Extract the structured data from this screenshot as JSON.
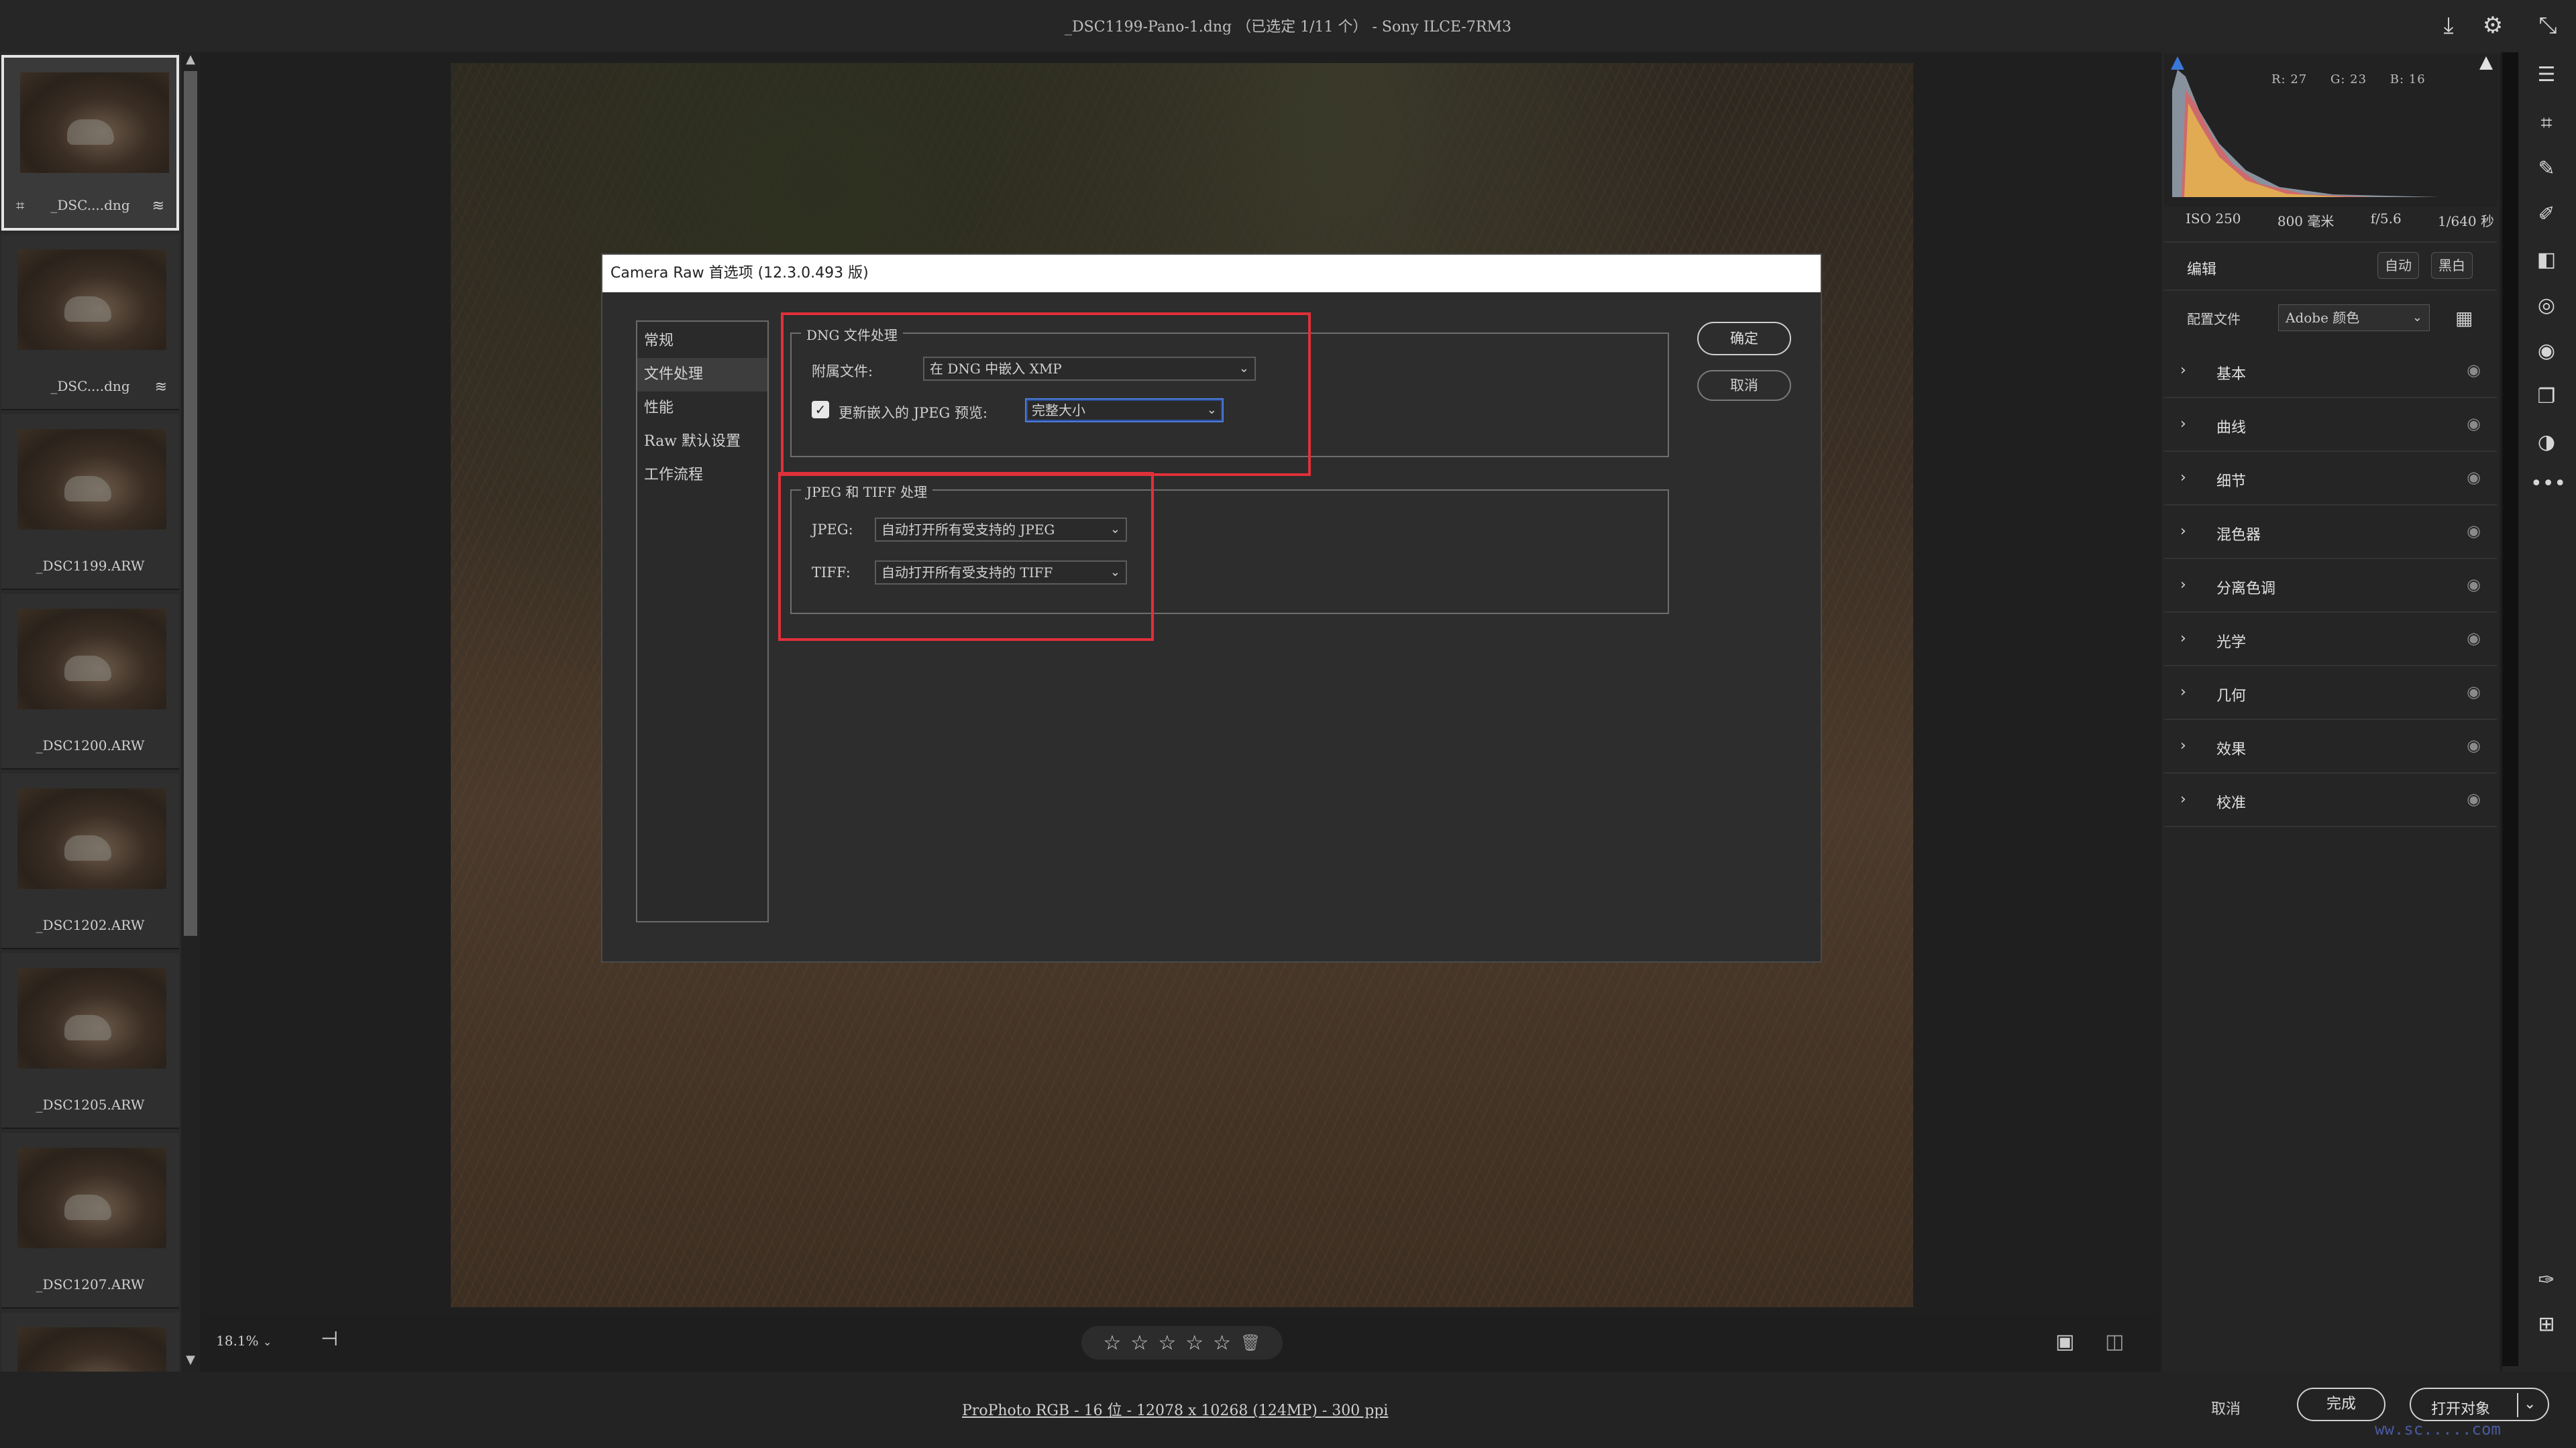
{
  "window": {
    "title": "_DSC1199-Pano-1.dng （已选定 1/11 个） - Sony ILCE-7RM3",
    "save_icon": "save-icon",
    "settings_icon": "gear-icon",
    "fullscreen_icon": "fullscreen-icon"
  },
  "filmstrip": {
    "items": [
      {
        "name": "_DSC....dng",
        "selected": true,
        "left_icon": "crop-icon",
        "right_icon": "adjust-icon"
      },
      {
        "name": "_DSC....dng",
        "selected": false,
        "left_icon": "",
        "right_icon": "adjust-icon"
      },
      {
        "name": "_DSC1199.ARW",
        "selected": false
      },
      {
        "name": "_DSC1200.ARW",
        "selected": false
      },
      {
        "name": "_DSC1202.ARW",
        "selected": false
      },
      {
        "name": "_DSC1205.ARW",
        "selected": false
      },
      {
        "name": "_DSC1207.ARW",
        "selected": false
      }
    ]
  },
  "canvas": {
    "zoom": "18.1%"
  },
  "rating": {
    "stars": 0,
    "max": 5
  },
  "histogram": {
    "r": "R: 27",
    "g": "G: 23",
    "b": "B: 16"
  },
  "exif": {
    "iso": "ISO 250",
    "focal": "800 毫米",
    "aperture": "f/5.6",
    "shutter": "1/640 秒"
  },
  "edit": {
    "title": "编辑",
    "auto": "自动",
    "bw": "黑白",
    "profile_label": "配置文件",
    "profile_value": "Adobe 颜色",
    "sections": [
      "基本",
      "曲线",
      "细节",
      "混色器",
      "分离色调",
      "光学",
      "几何",
      "效果",
      "校准"
    ]
  },
  "dialog": {
    "title": "Camera Raw 首选项 (12.3.0.493 版)",
    "nav": [
      "常规",
      "文件处理",
      "性能",
      "Raw 默认设置",
      "工作流程"
    ],
    "active_nav": 1,
    "dng_group": {
      "title": "DNG 文件处理",
      "sidecar_label": "附属文件:",
      "sidecar_value": "在 DNG 中嵌入 XMP",
      "update_preview_label": "更新嵌入的 JPEG 预览:",
      "update_preview_checked": true,
      "preview_size_value": "完整大小"
    },
    "jpeg_group": {
      "title": "JPEG 和 TIFF 处理",
      "jpeg_label": "JPEG:",
      "jpeg_value": "自动打开所有受支持的 JPEG",
      "tiff_label": "TIFF:",
      "tiff_value": "自动打开所有受支持的 TIFF"
    },
    "ok": "确定",
    "cancel": "取消"
  },
  "footer": {
    "workflow": "ProPhoto RGB - 16 位 - 12078 x 10268 (124MP) - 300 ppi",
    "cancel": "取消",
    "done": "完成",
    "open": "打开对象"
  },
  "colors": {
    "highlight_box": "#e0303a",
    "focus": "#4d7bd9"
  }
}
